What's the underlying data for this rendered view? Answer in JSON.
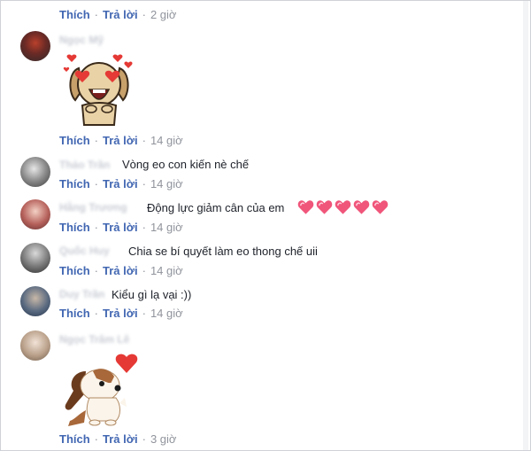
{
  "labels": {
    "like": "Thích",
    "reply": "Trả lời",
    "separator": "·"
  },
  "comments": [
    {
      "time": "2 giờ"
    },
    {
      "name": "Ngọc Mỹ",
      "time": "14 giờ"
    },
    {
      "name": "Thảo Trần",
      "text": "Vòng eo con kiến nè chế",
      "time": "14 giờ"
    },
    {
      "name": "Hằng Trương",
      "text": "Động lực giảm cân của em",
      "time": "14 giờ"
    },
    {
      "name": "Quốc Huy",
      "text": "Chia se bí quyết làm eo thong chế uii",
      "time": "14 giờ"
    },
    {
      "name": "Duy Trần",
      "text": "Kiểu gì lạ vại :))",
      "time": "14 giờ"
    },
    {
      "name": "Ngọc Trâm Lê",
      "time": "3 giờ"
    }
  ],
  "colors": {
    "link": "#4267b2",
    "meta": "#90949c",
    "text": "#1d2129",
    "heart": "#f0557a"
  },
  "icons": {
    "reaction": "pink-heart-icon",
    "sticker1": "heart-eyes-dog-sticker",
    "sticker2": "dog-with-heart-sticker"
  }
}
